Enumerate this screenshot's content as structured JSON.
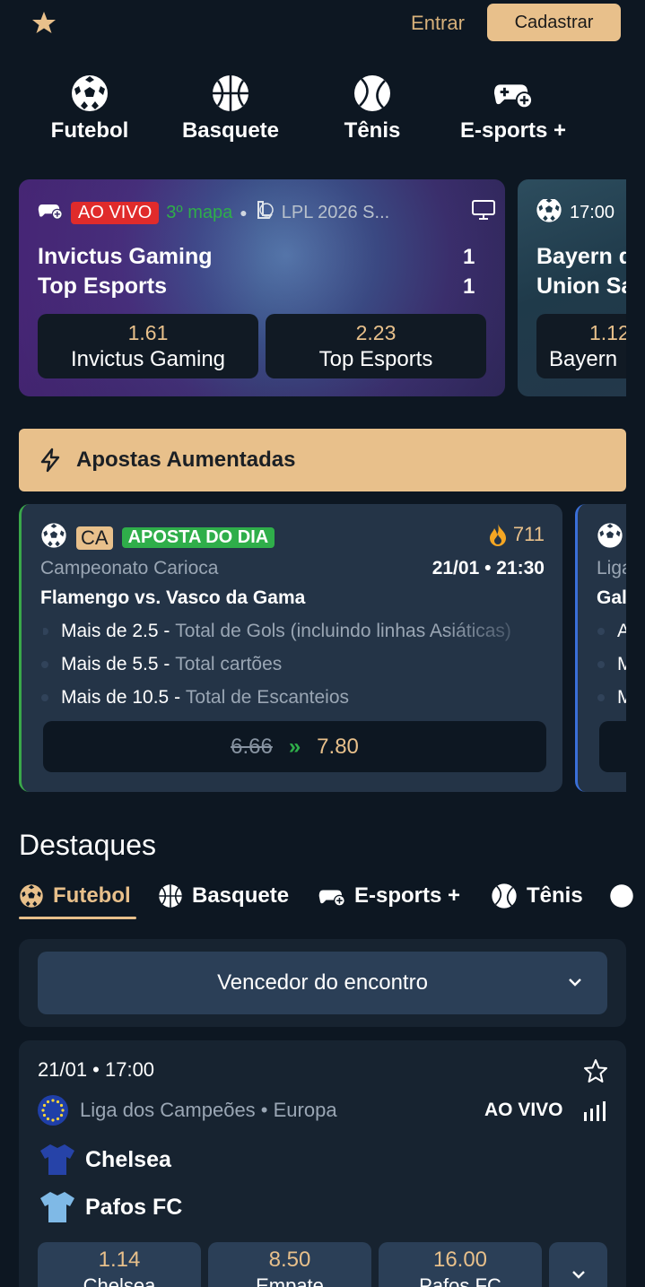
{
  "header": {
    "logo_icon": "star-icon",
    "login_label": "Entrar",
    "signup_label": "Cadastrar"
  },
  "sports_nav": [
    {
      "label": "Futebol",
      "icon": "soccer-ball-icon"
    },
    {
      "label": "Basquete",
      "icon": "basketball-icon"
    },
    {
      "label": "Tênis",
      "icon": "tennis-ball-icon"
    },
    {
      "label": "E-sports +",
      "icon": "gamepad-plus-icon"
    }
  ],
  "live_cards": [
    {
      "status": "AO VIVO",
      "period": "3º mapa",
      "league": "LPL 2026 S...",
      "team1": "Invictus Gaming",
      "team2": "Top Esports",
      "score1": "1",
      "score2": "1",
      "odds": [
        {
          "value": "1.61",
          "name": "Invictus Gaming"
        },
        {
          "value": "2.23",
          "name": "Top Esports"
        }
      ]
    },
    {
      "time": "17:00",
      "team1": "Bayern d",
      "team2": "Union Sa",
      "odds": [
        {
          "value": "1.12",
          "name": "Bayern"
        }
      ]
    }
  ],
  "boosted": {
    "title": "Apostas Aumentadas",
    "card": {
      "league_abbr": "CA",
      "badge": "APOSTA DO DIA",
      "count": "711",
      "league": "Campeonato Carioca",
      "datetime": "21/01 • 21:30",
      "match": "Flamengo vs. Vasco da Gama",
      "selections": [
        {
          "pick": "Mais de 2.5 -",
          "market": "Total de Gols (incluindo linhas Asiáticas)"
        },
        {
          "pick": "Mais de 5.5 -",
          "market": "Total cartões"
        },
        {
          "pick": "Mais de 10.5 -",
          "market": "Total de Escanteios"
        }
      ],
      "old_odds": "6.66",
      "arrow": "»",
      "new_odds": "7.80"
    },
    "card2": {
      "league": "Liga",
      "match": "Gal",
      "selections": [
        "A",
        "M",
        "M"
      ]
    }
  },
  "highlights": {
    "title": "Destaques",
    "tabs": [
      {
        "label": "Futebol",
        "icon": "soccer-ball-icon",
        "active": true
      },
      {
        "label": "Basquete",
        "icon": "basketball-icon"
      },
      {
        "label": "E-sports +",
        "icon": "gamepad-plus-icon"
      },
      {
        "label": "Tênis",
        "icon": "tennis-ball-icon"
      }
    ],
    "market_select": "Vencedor do encontro",
    "match": {
      "datetime": "21/01 • 17:00",
      "league": "Liga dos Campeões • Europa",
      "status": "AO VIVO",
      "team1": "Chelsea",
      "team2": "Pafos FC",
      "odds": [
        {
          "value": "1.14",
          "name": "Chelsea"
        },
        {
          "value": "8.50",
          "name": "Empate"
        },
        {
          "value": "16.00",
          "name": "Pafos FC"
        }
      ]
    }
  },
  "colors": {
    "background": "#0d1722",
    "accent": "#e8c08b",
    "live_red": "#e02b2b",
    "green": "#2fae4a",
    "card": "#243447"
  }
}
